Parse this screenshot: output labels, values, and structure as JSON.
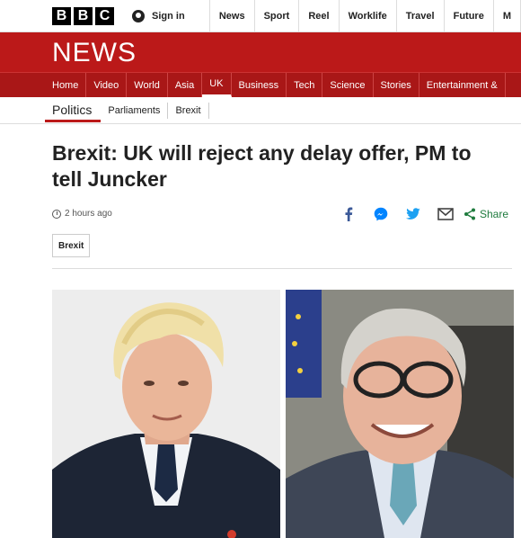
{
  "header": {
    "logo_letters": [
      "B",
      "B",
      "C"
    ],
    "sign_in": "Sign in",
    "links": [
      "News",
      "Sport",
      "Reel",
      "Worklife",
      "Travel",
      "Future",
      "M"
    ]
  },
  "banner": {
    "title": "NEWS"
  },
  "main_nav": {
    "items": [
      "Home",
      "Video",
      "World",
      "Asia",
      "UK",
      "Business",
      "Tech",
      "Science",
      "Stories",
      "Entertainment &"
    ],
    "active": "UK"
  },
  "sub_nav": {
    "current": "Politics",
    "items": [
      "Parliaments",
      "Brexit"
    ]
  },
  "article": {
    "headline": "Brexit: UK will reject any delay offer, PM to tell Juncker",
    "timestamp": "2 hours ago",
    "share_label": "Share",
    "tag": "Brexit"
  },
  "colors": {
    "brand_red": "#bb1919",
    "share_green": "#1e7b3d",
    "facebook": "#3b5998",
    "messenger": "#0084ff",
    "twitter": "#1da1f2"
  },
  "icons": [
    "user-icon",
    "clock-icon",
    "facebook-icon",
    "messenger-icon",
    "twitter-icon",
    "email-icon",
    "share-icon"
  ]
}
